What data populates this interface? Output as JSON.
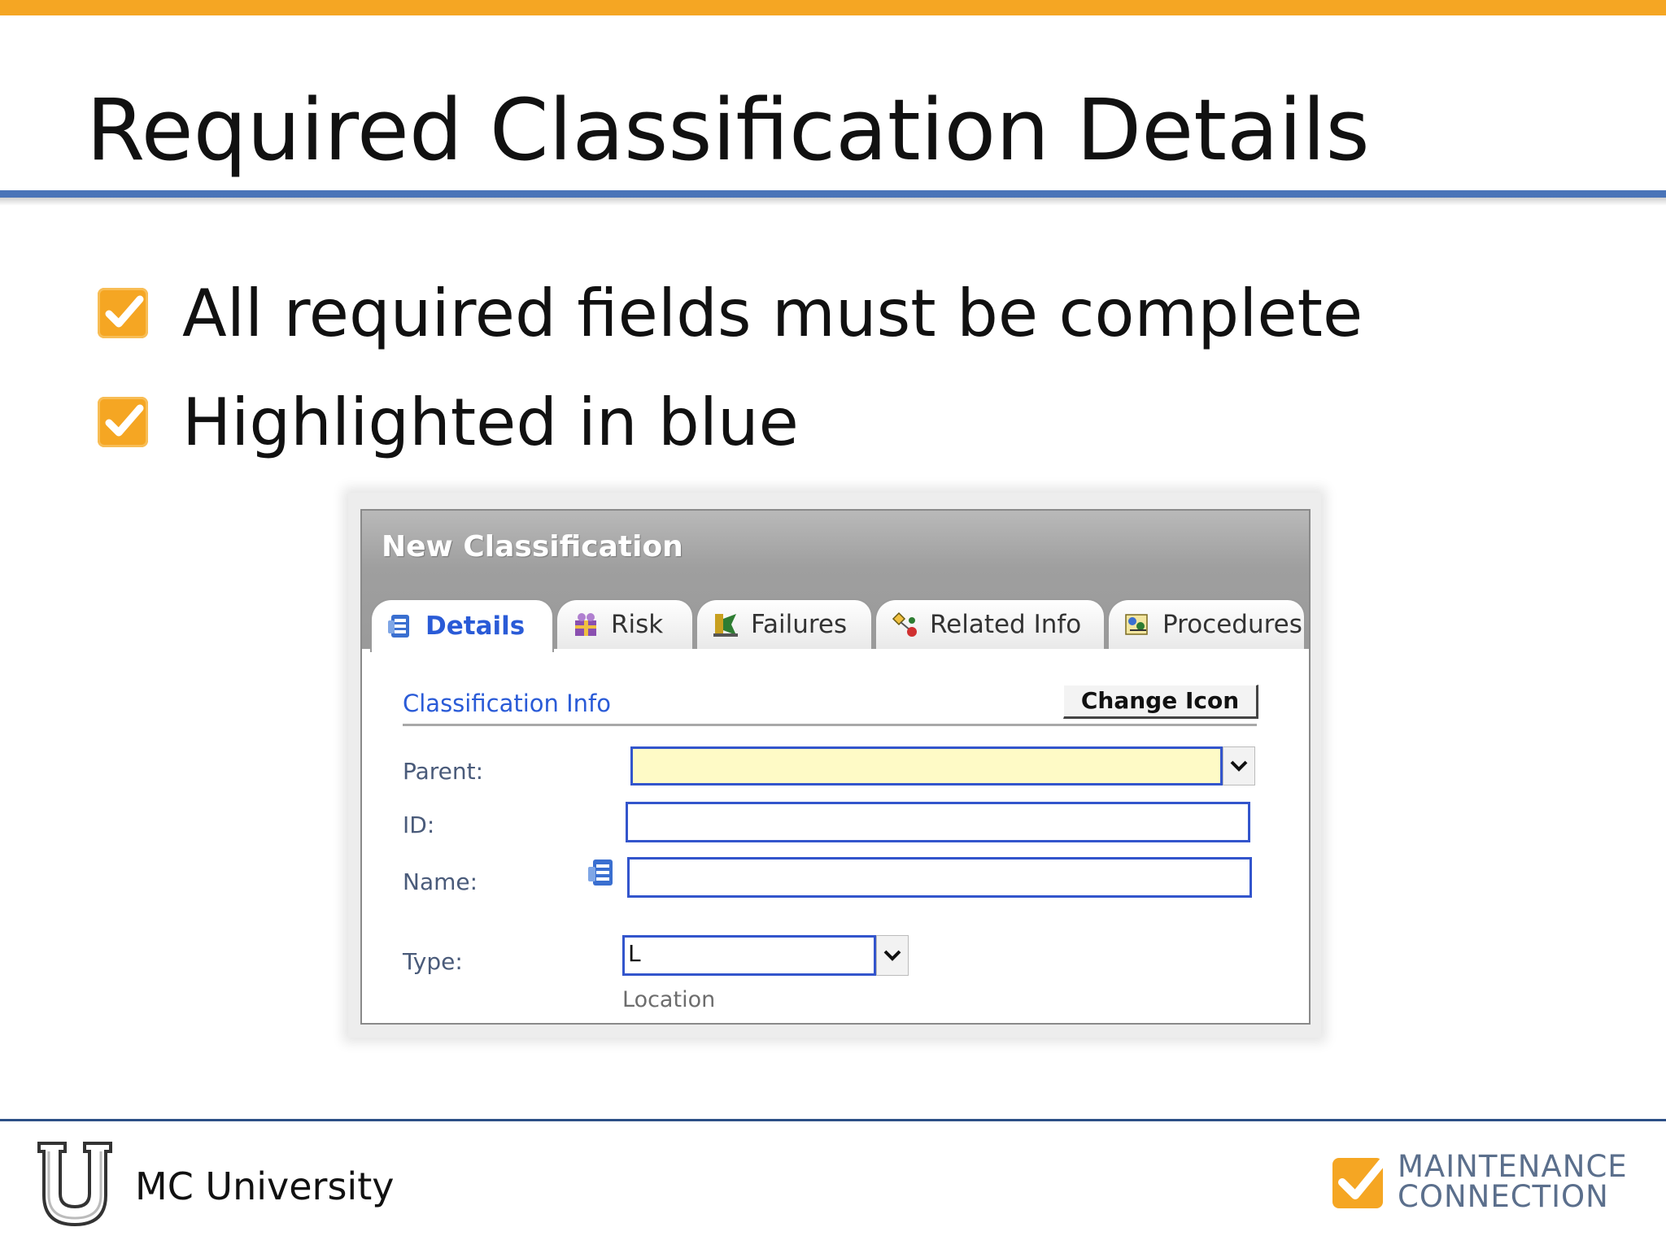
{
  "slide": {
    "title": "Required Classification Details",
    "bullets": [
      "All required fields must be complete",
      "Highlighted in blue"
    ]
  },
  "dialog": {
    "title": "New Classification",
    "tabs": [
      {
        "label": "Details",
        "icon": "details-icon",
        "active": true
      },
      {
        "label": "Risk",
        "icon": "risk-icon",
        "active": false
      },
      {
        "label": "Failures",
        "icon": "failures-icon",
        "active": false
      },
      {
        "label": "Related Info",
        "icon": "related-info-icon",
        "active": false
      },
      {
        "label": "Procedures",
        "icon": "procedures-icon",
        "active": false
      }
    ],
    "section_title": "Classification Info",
    "change_icon_label": "Change Icon",
    "fields": {
      "parent": {
        "label": "Parent:",
        "value": ""
      },
      "id": {
        "label": "ID:",
        "value": ""
      },
      "name": {
        "label": "Name:",
        "value": ""
      },
      "type": {
        "label": "Type:",
        "value": "L",
        "caption": "Location"
      }
    },
    "colors": {
      "required_border": "#3355cc",
      "required_fill": "#fefac6",
      "accent_blue": "#2a5bd7"
    }
  },
  "footer": {
    "university": "MC University",
    "brand_line1": "MAINTENANCE",
    "brand_line2": "CONNECTION"
  },
  "colors": {
    "top_bar": "#f5a623",
    "title_rule": "#4a74b8",
    "footer_rule": "#2c4f86"
  }
}
